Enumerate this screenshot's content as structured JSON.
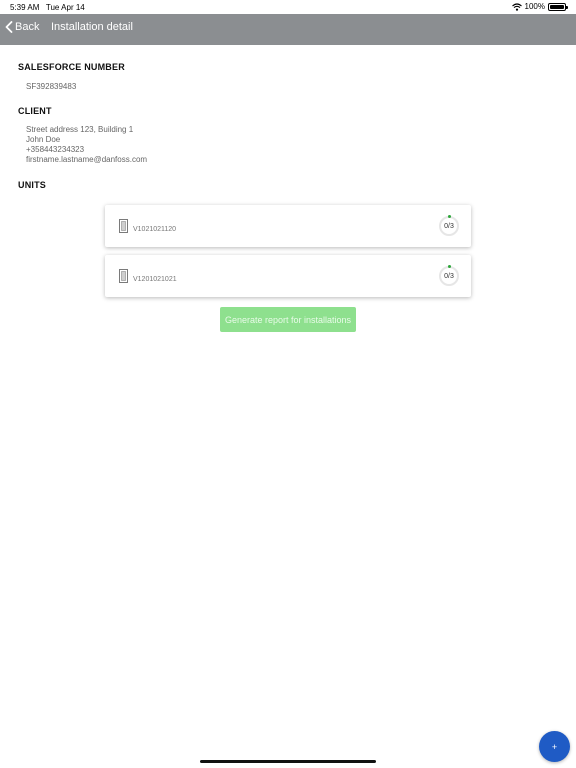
{
  "status_bar": {
    "time": "5:39 AM",
    "date": "Tue Apr 14",
    "battery": "100%"
  },
  "navbar": {
    "back_label": "Back",
    "title": "Installation detail"
  },
  "salesforce": {
    "heading": "SALESFORCE NUMBER",
    "value": "SF392839483"
  },
  "client": {
    "heading": "CLIENT",
    "address": "Street address 123, Building 1",
    "name": "John Doe",
    "phone": "+358443234323",
    "email": "firstname.lastname@danfoss.com"
  },
  "units": {
    "heading": "UNITS",
    "items": [
      {
        "id": "V1021021120",
        "progress": "0/3"
      },
      {
        "id": "V1201021021",
        "progress": "0/3"
      }
    ]
  },
  "actions": {
    "generate_label": "Generate report for installations",
    "fab_label": "+"
  },
  "colors": {
    "navbar": "#8b8e91",
    "button_disabled": "#8ee08e",
    "fab": "#1f5bc5",
    "progress_dot": "#2ca53a"
  }
}
